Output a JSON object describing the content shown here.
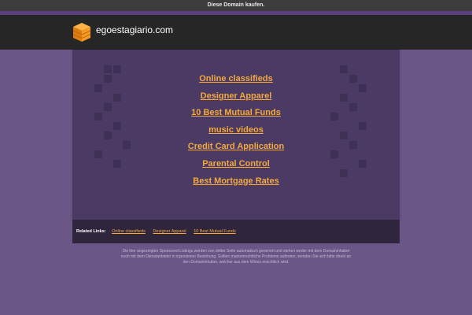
{
  "top_bar": {
    "label": "Diese Domain kaufen."
  },
  "header": {
    "site_name": "egoestagiario.com",
    "logo_icon": "orange-cube-icon"
  },
  "main_links": [
    "Online classifieds",
    "Designer Apparel",
    "10 Best Mutual Funds",
    "music videos",
    "Credit Card Application",
    "Parental Control",
    "Best Mortgage Rates"
  ],
  "related": {
    "label": "Related Links:",
    "links": [
      "Online classifieds",
      "Designer Apparel",
      "10 Best Mutual Funds"
    ]
  },
  "disclaimer": "Die hier angezeigten Sponsored Listings werden von dritter Seite automatisch generiert und stehen weder mit dem Domaininhaber noch mit dem Dienstanbieter in irgendeiner Beziehung. Sollten markenrechtliche Probleme auftreten, wenden Sie sich bitte direkt an den Domaininhaber, welcher aus dem Whois ersichtlich wird.",
  "colors": {
    "background": "#6a5687",
    "panel": "#4a3a64",
    "link": "#f4a93b",
    "header": "#262626"
  }
}
